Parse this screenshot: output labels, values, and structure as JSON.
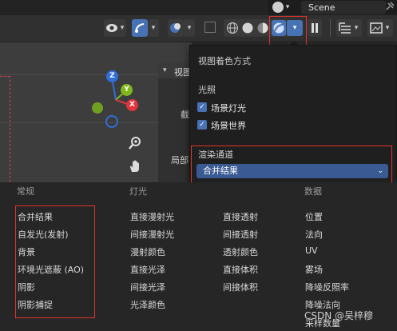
{
  "top": {
    "scene_label": "Scene",
    "pin_glyph": "✓"
  },
  "viewport": {
    "axes": {
      "z": "Z",
      "y": "Y",
      "x": "X"
    }
  },
  "side_panel": {
    "header_label": "视图",
    "label1": "截",
    "label2": "局部"
  },
  "popover": {
    "title": "视图着色方式",
    "lighting_header": "光照",
    "checkbox1": "场景灯光",
    "checkbox2": "场景世界",
    "render_pass_header": "渲染通道",
    "render_pass_value": "合并结果"
  },
  "bottom": {
    "headers": {
      "general": "常规",
      "light": "灯光",
      "data": "数据"
    },
    "general_items": [
      "合并结果",
      "自发光(发射)",
      "背景",
      "环境光遮蔽 (AO)",
      "阴影",
      "阴影捕捉"
    ],
    "light_col1": [
      "直接漫射光",
      "间接漫射光",
      "漫射颜色",
      "直接光泽",
      "间接光泽",
      "光泽颜色"
    ],
    "light_col2": [
      "直接透射",
      "间接透射",
      "透射颜色",
      "直接体积",
      "间接体积"
    ],
    "data_items": [
      "位置",
      "法向",
      "UV",
      "雾场",
      "降噪反照率",
      "降噪法向",
      "采样数量"
    ]
  },
  "watermark": "CSDN @吴梓穆",
  "colors": {
    "accent_blue": "#4772b3",
    "dropdown_blue": "#3a5a93",
    "annotation_red": "#e0352b",
    "axis_z": "#2f6fd8",
    "axis_y": "#7fb81a",
    "axis_x": "#e2343d"
  }
}
